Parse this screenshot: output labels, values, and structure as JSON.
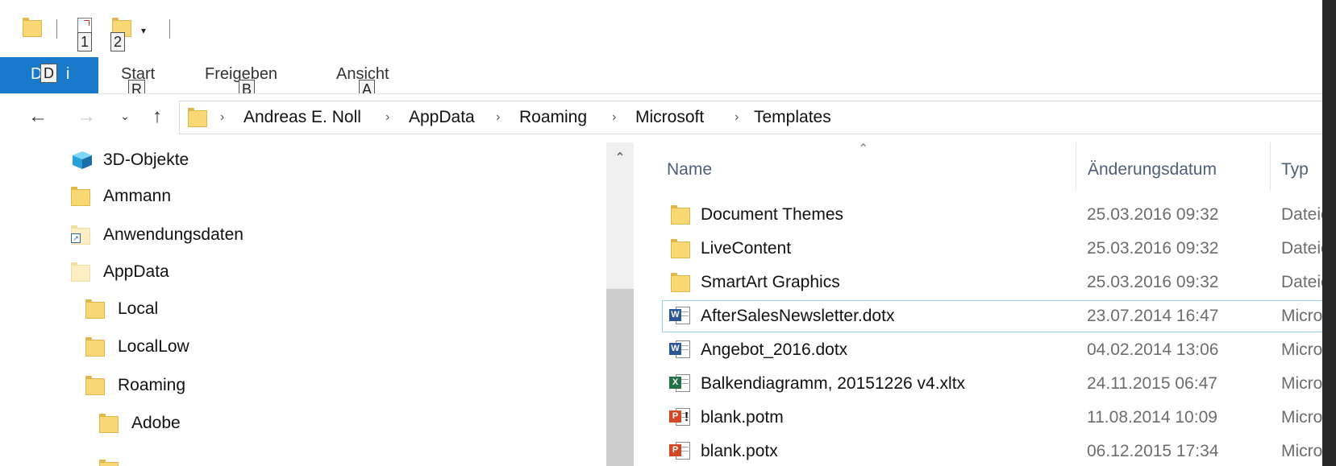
{
  "quick_access": {
    "keytips": [
      "1",
      "2"
    ]
  },
  "ribbon": {
    "tabs": [
      {
        "label": "Datei",
        "keytip": "D"
      },
      {
        "label": "Start",
        "keytip": "R"
      },
      {
        "label": "Freigeben",
        "keytip": "B"
      },
      {
        "label": "Ansicht",
        "keytip": "A"
      }
    ],
    "datei_label_left": "D",
    "datei_label_right": "i"
  },
  "nav": {
    "back_icon": "←",
    "forward_icon": "→",
    "recent_icon": "⌄",
    "up_icon": "↑"
  },
  "breadcrumb": [
    "Andreas E. Noll",
    "AppData",
    "Roaming",
    "Microsoft",
    "Templates"
  ],
  "tree": [
    {
      "label": "3D-Objekte",
      "icon": "cube-icon"
    },
    {
      "label": "Ammann",
      "icon": "folder-icon"
    },
    {
      "label": "Anwendungsdaten",
      "icon": "shortcut-folder-icon"
    },
    {
      "label": "AppData",
      "icon": "folder-icon"
    },
    {
      "label": "Local",
      "icon": "folder-icon"
    },
    {
      "label": "LocalLow",
      "icon": "folder-icon"
    },
    {
      "label": "Roaming",
      "icon": "folder-icon"
    },
    {
      "label": "Adobe",
      "icon": "folder-icon"
    }
  ],
  "columns": {
    "name": "Name",
    "date": "Änderungsdatum",
    "type": "Typ"
  },
  "files": [
    {
      "name": "Document Themes",
      "date": "25.03.2016 09:32",
      "type": "Dateio",
      "icon": "folder-icon"
    },
    {
      "name": "LiveContent",
      "date": "25.03.2016 09:32",
      "type": "Dateio",
      "icon": "folder-icon"
    },
    {
      "name": "SmartArt Graphics",
      "date": "25.03.2016 09:32",
      "type": "Dateio",
      "icon": "folder-icon"
    },
    {
      "name": "AfterSalesNewsletter.dotx",
      "date": "23.07.2014 16:47",
      "type": "Micros",
      "icon": "word-template-icon",
      "badge": "W",
      "color": "#2b579a"
    },
    {
      "name": "Angebot_2016.dotx",
      "date": "04.02.2014 13:06",
      "type": "Micros",
      "icon": "word-template-icon",
      "badge": "W",
      "color": "#2b579a"
    },
    {
      "name": "Balkendiagramm, 20151226 v4.xltx",
      "date": "24.11.2015 06:47",
      "type": "Micros",
      "icon": "excel-template-icon",
      "badge": "X",
      "color": "#217346"
    },
    {
      "name": "blank.potm",
      "date": "11.08.2014 10:09",
      "type": "Micros",
      "icon": "powerpoint-macro-template-icon",
      "badge": "P",
      "color": "#d24726"
    },
    {
      "name": "blank.potx",
      "date": "06.12.2015 17:34",
      "type": "Micros",
      "icon": "powerpoint-template-icon",
      "badge": "P",
      "color": "#d24726"
    }
  ],
  "colors": {
    "accent": "#1979ca",
    "selection_border": "#99c9ef",
    "folder": "#f8d775"
  }
}
